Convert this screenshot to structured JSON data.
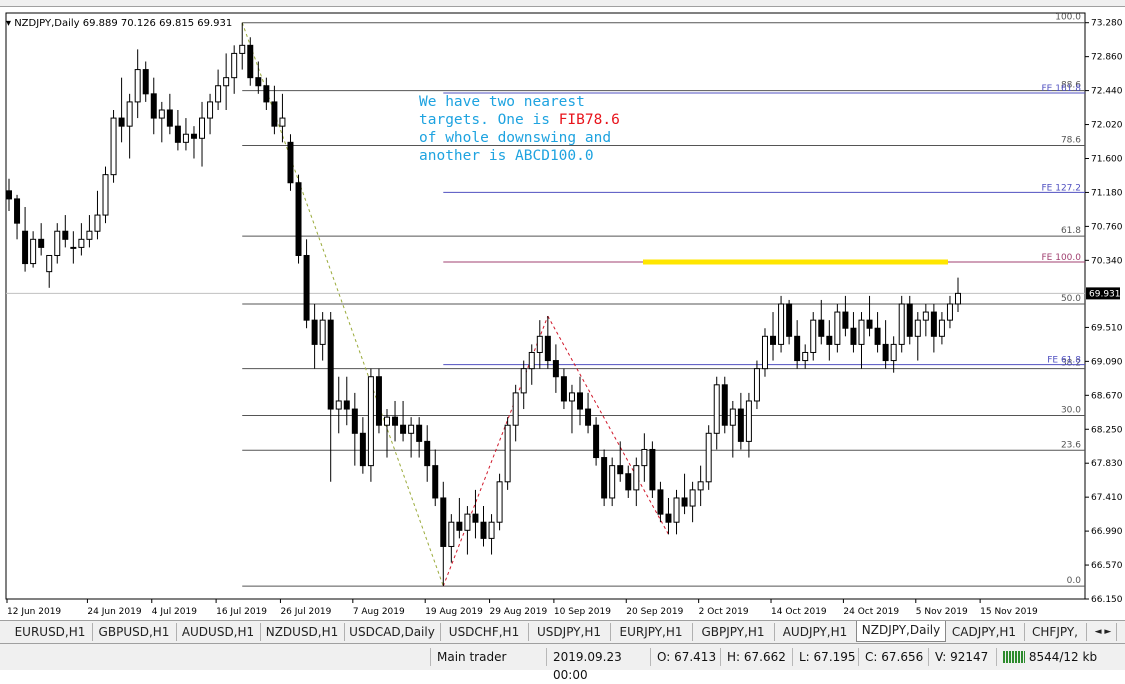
{
  "window": {
    "symbol_header": "NZDJPY,Daily  69.889 70.126 69.815 69.931"
  },
  "annotation": {
    "line1": "We have two nearest",
    "line2a": "targets. One is ",
    "line2b": "FIB78.6",
    "line3": "of whole downswing and",
    "line4": "another is ABCD100.0",
    "text_color": "#1ea3e0",
    "highlight_color": "#e8141c"
  },
  "chart_data": {
    "type": "candlestick",
    "symbol": "NZDJPY",
    "timeframe": "Daily",
    "last_price": "69.931",
    "ylim": [
      66.15,
      73.4
    ],
    "y_ticks": [
      "73.280",
      "72.860",
      "72.440",
      "72.020",
      "71.600",
      "71.180",
      "70.760",
      "70.340",
      "69.931",
      "69.510",
      "69.090",
      "68.670",
      "68.250",
      "67.830",
      "67.410",
      "66.990",
      "66.570",
      "66.150"
    ],
    "x_ticks": [
      "12 Jun 2019",
      "24 Jun 2019",
      "4 Jul 2019",
      "16 Jul 2019",
      "26 Jul 2019",
      "7 Aug 2019",
      "19 Aug 2019",
      "29 Aug 2019",
      "10 Sep 2019",
      "20 Sep 2019",
      "2 Oct 2019",
      "14 Oct 2019",
      "24 Oct 2019",
      "5 Nov 2019",
      "15 Nov 2019"
    ],
    "fib_levels": [
      {
        "label": "100.0",
        "price": 73.28
      },
      {
        "label": "88.6",
        "price": 72.44
      },
      {
        "label": "78.6",
        "price": 71.76
      },
      {
        "label": "61.8",
        "price": 70.64
      },
      {
        "label": "50.0",
        "price": 69.8
      },
      {
        "label": "38.2",
        "price": 69.0
      },
      {
        "label": "30.0",
        "price": 68.42
      },
      {
        "label": "23.6",
        "price": 67.99
      },
      {
        "label": "0.0",
        "price": 66.31
      }
    ],
    "fe_levels": [
      {
        "label": "FE 161.8",
        "price": 72.41
      },
      {
        "label": "FE 127.2",
        "price": 71.18
      },
      {
        "label": "FE 100.0",
        "price": 70.32
      },
      {
        "label": "FE 61.8",
        "price": 69.05
      }
    ],
    "target_line": {
      "price": 70.32,
      "color": "#ffe600"
    },
    "candles": [
      [
        71.2,
        71.35,
        70.95,
        71.1
      ],
      [
        71.1,
        71.15,
        70.6,
        70.8
      ],
      [
        70.7,
        71.0,
        70.2,
        70.3
      ],
      [
        70.3,
        70.7,
        70.25,
        70.6
      ],
      [
        70.6,
        70.8,
        70.4,
        70.5
      ],
      [
        70.2,
        70.4,
        70.0,
        70.4
      ],
      [
        70.4,
        70.8,
        70.3,
        70.7
      ],
      [
        70.7,
        70.9,
        70.5,
        70.6
      ],
      [
        70.5,
        70.7,
        70.3,
        70.5
      ],
      [
        70.5,
        70.8,
        70.4,
        70.6
      ],
      [
        70.6,
        70.9,
        70.5,
        70.7
      ],
      [
        70.7,
        71.2,
        70.6,
        70.9
      ],
      [
        70.9,
        71.5,
        70.8,
        71.4
      ],
      [
        71.4,
        72.2,
        71.3,
        72.1
      ],
      [
        72.1,
        72.6,
        71.8,
        72.0
      ],
      [
        72.0,
        72.4,
        71.6,
        72.3
      ],
      [
        72.3,
        72.95,
        72.1,
        72.7
      ],
      [
        72.7,
        72.8,
        72.3,
        72.4
      ],
      [
        72.4,
        72.6,
        71.9,
        72.1
      ],
      [
        72.1,
        72.3,
        71.8,
        72.2
      ],
      [
        72.2,
        72.4,
        71.9,
        72.0
      ],
      [
        72.0,
        72.2,
        71.7,
        71.8
      ],
      [
        71.8,
        72.1,
        71.7,
        71.9
      ],
      [
        71.9,
        72.0,
        71.6,
        71.85
      ],
      [
        71.85,
        72.3,
        71.5,
        72.1
      ],
      [
        72.1,
        72.4,
        71.9,
        72.3
      ],
      [
        72.3,
        72.7,
        72.2,
        72.5
      ],
      [
        72.5,
        72.9,
        72.2,
        72.6
      ],
      [
        72.6,
        73.0,
        72.4,
        72.9
      ],
      [
        72.9,
        73.28,
        72.7,
        73.0
      ],
      [
        73.0,
        73.1,
        72.5,
        72.6
      ],
      [
        72.6,
        72.8,
        72.4,
        72.5
      ],
      [
        72.5,
        72.6,
        72.2,
        72.3
      ],
      [
        72.3,
        72.5,
        71.9,
        72.0
      ],
      [
        72.0,
        72.4,
        71.8,
        72.1
      ],
      [
        71.8,
        71.9,
        71.2,
        71.3
      ],
      [
        71.3,
        71.4,
        70.3,
        70.4
      ],
      [
        70.4,
        70.6,
        69.5,
        69.6
      ],
      [
        69.6,
        69.8,
        69.0,
        69.3
      ],
      [
        69.3,
        69.7,
        69.1,
        69.6
      ],
      [
        69.6,
        69.7,
        67.6,
        68.5
      ],
      [
        68.5,
        68.9,
        68.2,
        68.6
      ],
      [
        68.6,
        68.9,
        68.3,
        68.5
      ],
      [
        68.5,
        68.7,
        67.8,
        68.2
      ],
      [
        68.2,
        68.4,
        67.7,
        67.8
      ],
      [
        67.8,
        69.0,
        67.6,
        68.9
      ],
      [
        68.9,
        69.0,
        68.2,
        68.3
      ],
      [
        68.3,
        68.5,
        67.9,
        68.4
      ],
      [
        68.4,
        68.6,
        68.1,
        68.3
      ],
      [
        68.3,
        68.6,
        68.1,
        68.2
      ],
      [
        68.2,
        68.4,
        67.9,
        68.3
      ],
      [
        68.3,
        68.4,
        67.9,
        68.1
      ],
      [
        68.1,
        68.3,
        67.6,
        67.8
      ],
      [
        67.8,
        68.0,
        67.3,
        67.4
      ],
      [
        67.4,
        67.6,
        66.31,
        66.8
      ],
      [
        66.8,
        67.2,
        66.6,
        67.1
      ],
      [
        67.1,
        67.4,
        66.9,
        67.0
      ],
      [
        67.0,
        67.3,
        66.7,
        67.2
      ],
      [
        67.2,
        67.5,
        66.9,
        67.1
      ],
      [
        67.1,
        67.3,
        66.8,
        66.9
      ],
      [
        66.9,
        67.2,
        66.7,
        67.1
      ],
      [
        67.1,
        67.7,
        67.0,
        67.6
      ],
      [
        67.6,
        68.4,
        67.5,
        68.3
      ],
      [
        68.3,
        68.8,
        68.1,
        68.7
      ],
      [
        68.7,
        69.1,
        68.5,
        69.0
      ],
      [
        69.0,
        69.3,
        68.8,
        69.2
      ],
      [
        69.2,
        69.6,
        69.0,
        69.4
      ],
      [
        69.4,
        69.65,
        69.0,
        69.1
      ],
      [
        69.1,
        69.3,
        68.7,
        68.9
      ],
      [
        68.9,
        69.0,
        68.5,
        68.6
      ],
      [
        68.6,
        68.8,
        68.2,
        68.7
      ],
      [
        68.7,
        68.9,
        68.3,
        68.5
      ],
      [
        68.5,
        68.7,
        68.2,
        68.3
      ],
      [
        68.3,
        68.4,
        67.8,
        67.9
      ],
      [
        67.9,
        68.0,
        67.3,
        67.4
      ],
      [
        67.4,
        67.9,
        67.3,
        67.8
      ],
      [
        67.8,
        68.1,
        67.6,
        67.7
      ],
      [
        67.7,
        67.8,
        67.4,
        67.5
      ],
      [
        67.5,
        67.9,
        67.3,
        67.8
      ],
      [
        67.8,
        68.2,
        67.6,
        68.0
      ],
      [
        68.0,
        68.1,
        67.4,
        67.5
      ],
      [
        67.5,
        67.6,
        67.1,
        67.2
      ],
      [
        67.2,
        67.4,
        66.95,
        67.1
      ],
      [
        67.1,
        67.5,
        66.95,
        67.4
      ],
      [
        67.4,
        67.7,
        67.2,
        67.3
      ],
      [
        67.3,
        67.6,
        67.1,
        67.5
      ],
      [
        67.5,
        67.8,
        67.3,
        67.6
      ],
      [
        67.6,
        68.3,
        67.5,
        68.2
      ],
      [
        68.2,
        68.9,
        68.0,
        68.8
      ],
      [
        68.8,
        68.9,
        68.2,
        68.3
      ],
      [
        68.3,
        68.6,
        67.9,
        68.5
      ],
      [
        68.5,
        68.7,
        68.0,
        68.1
      ],
      [
        68.1,
        68.7,
        67.9,
        68.6
      ],
      [
        68.6,
        69.1,
        68.5,
        69.0
      ],
      [
        69.0,
        69.5,
        68.9,
        69.4
      ],
      [
        69.4,
        69.7,
        69.1,
        69.3
      ],
      [
        69.3,
        69.9,
        69.2,
        69.8
      ],
      [
        69.8,
        69.85,
        69.3,
        69.4
      ],
      [
        69.4,
        69.6,
        69.0,
        69.1
      ],
      [
        69.1,
        69.3,
        69.0,
        69.2
      ],
      [
        69.2,
        69.7,
        69.1,
        69.6
      ],
      [
        69.6,
        69.85,
        69.3,
        69.4
      ],
      [
        69.4,
        69.6,
        69.1,
        69.3
      ],
      [
        69.3,
        69.8,
        69.2,
        69.7
      ],
      [
        69.7,
        69.9,
        69.4,
        69.5
      ],
      [
        69.5,
        69.7,
        69.2,
        69.3
      ],
      [
        69.3,
        69.7,
        69.0,
        69.6
      ],
      [
        69.6,
        69.9,
        69.4,
        69.5
      ],
      [
        69.5,
        69.7,
        69.2,
        69.3
      ],
      [
        69.3,
        69.6,
        69.0,
        69.1
      ],
      [
        69.1,
        69.4,
        68.95,
        69.3
      ],
      [
        69.3,
        69.9,
        69.2,
        69.8
      ],
      [
        69.8,
        69.9,
        69.3,
        69.4
      ],
      [
        69.4,
        69.7,
        69.1,
        69.6
      ],
      [
        69.6,
        69.8,
        69.4,
        69.7
      ],
      [
        69.7,
        69.8,
        69.2,
        69.4
      ],
      [
        69.4,
        69.7,
        69.3,
        69.6
      ],
      [
        69.6,
        69.9,
        69.5,
        69.8
      ],
      [
        69.8,
        70.126,
        69.7,
        69.931
      ]
    ]
  },
  "tabs": [
    "EURUSD,H1",
    "GBPUSD,H1",
    "AUDUSD,H1",
    "NZDUSD,H1",
    "USDCAD,Daily",
    "USDCHF,H1",
    "USDJPY,H1",
    "EURJPY,H1",
    "GBPJPY,H1",
    "AUDJPY,H1",
    "NZDJPY,Daily",
    "CADJPY,H1",
    "CHFJPY,"
  ],
  "tab_scroll": "◄ ►",
  "status": {
    "profile": "Main trader",
    "datetime": "2019.09.23 00:00",
    "open": "O: 67.413",
    "high": "H: 67.662",
    "low": "L: 67.195",
    "close": "C: 67.656",
    "volume": "V: 92147",
    "traffic": "8544/12 kb"
  }
}
